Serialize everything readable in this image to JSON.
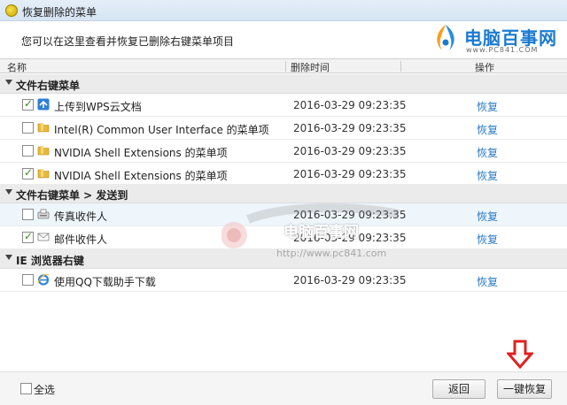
{
  "window": {
    "title": "恢复删除的菜单"
  },
  "subtitle": "您可以在这里查看并恢复已删除右键菜单项目",
  "logo": {
    "text": "电脑百事网",
    "url": "www.PC841.COM"
  },
  "table": {
    "columns": [
      "名称",
      "删除时间",
      "操作"
    ]
  },
  "groups": [
    {
      "label": "文件右键菜单",
      "rows": [
        {
          "name": "上传到WPS云文档",
          "time": "2016-03-29 09:23:35",
          "action": "恢复",
          "checked": true,
          "icon": "wps-cloud-icon"
        },
        {
          "name": "Intel(R) Common User Interface 的菜单项",
          "time": "2016-03-29 09:23:35",
          "action": "恢复",
          "checked": false,
          "icon": "folder-icon"
        },
        {
          "name": "NVIDIA Shell Extensions 的菜单项",
          "time": "2016-03-29 09:23:35",
          "action": "恢复",
          "checked": false,
          "icon": "folder-icon"
        },
        {
          "name": "NVIDIA Shell Extensions 的菜单项",
          "time": "2016-03-29 09:23:35",
          "action": "恢复",
          "checked": true,
          "icon": "folder-icon"
        }
      ]
    },
    {
      "label": "文件右键菜单 > 发送到",
      "rows": [
        {
          "name": "传真收件人",
          "time": "2016-03-29 09:23:35",
          "action": "恢复",
          "checked": false,
          "icon": "fax-icon"
        },
        {
          "name": "邮件收件人",
          "time": "2016-03-29 09:23:35",
          "action": "恢复",
          "checked": true,
          "icon": "mail-icon"
        }
      ]
    },
    {
      "label": "IE 浏览器右键",
      "rows": [
        {
          "name": "使用QQ下载助手下载",
          "time": "2016-03-29 09:23:35",
          "action": "恢复",
          "checked": false,
          "icon": "ie-icon"
        }
      ]
    }
  ],
  "watermark": {
    "text": "电脑百事网",
    "url": "http://www.pc841.com"
  },
  "footer": {
    "select_all": "全选",
    "back_button": "返回",
    "restore_all_button": "一键恢复"
  },
  "colors": {
    "link": "#2a79c4",
    "arrow": "#e02020",
    "check": "#3a8c1f"
  }
}
